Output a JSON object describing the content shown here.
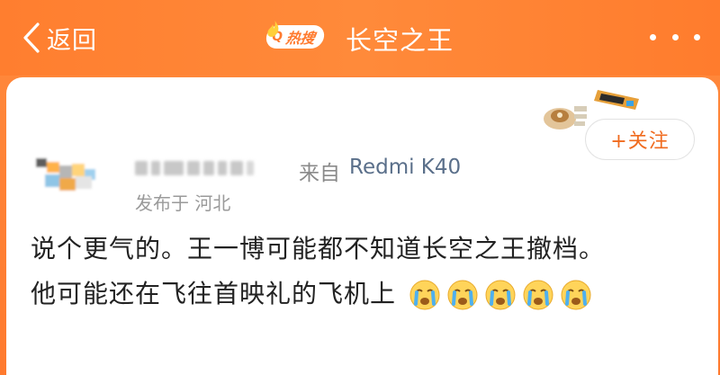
{
  "header": {
    "back_label": "返回",
    "hot_search_label": "热搜",
    "hot_search_icon": "search-icon",
    "title": "长空之王",
    "more_icon": "more-dots-icon",
    "accent": "#ff7e2f"
  },
  "post": {
    "follow_label": "+关注",
    "source_prefix": "来自",
    "device": "Redmi K40",
    "location": "发布于 河北",
    "content_line1": "说个更气的。王一博可能都不知道长空之王撤档。",
    "content_line2": "他可能还在飞往首映礼的飞机上",
    "emoji_name": "crying-face-emoji",
    "emoji_count": 5
  }
}
